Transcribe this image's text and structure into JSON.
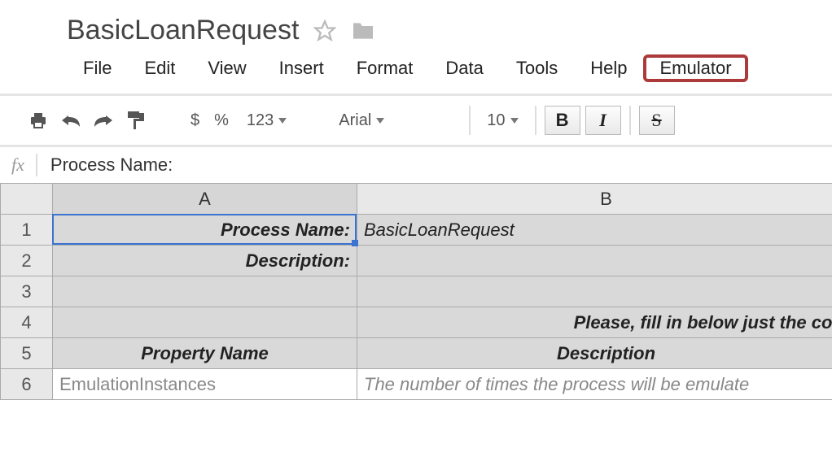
{
  "doc": {
    "title": "BasicLoanRequest"
  },
  "menu": {
    "file": "File",
    "edit": "Edit",
    "view": "View",
    "insert": "Insert",
    "format": "Format",
    "data": "Data",
    "tools": "Tools",
    "help": "Help",
    "emulator": "Emulator"
  },
  "toolbar": {
    "currency": "$",
    "percent": "%",
    "numfmt": "123",
    "font": "Arial",
    "size": "10",
    "bold": "B",
    "italic": "I",
    "strike": "S"
  },
  "formula": {
    "fx": "fx",
    "value": "Process Name:"
  },
  "columns": {
    "A": "A",
    "B": "B"
  },
  "rows": {
    "r1": {
      "num": "1",
      "a": "Process Name:",
      "b": "BasicLoanRequest"
    },
    "r2": {
      "num": "2",
      "a": "Description:",
      "b": ""
    },
    "r3": {
      "num": "3",
      "a": "",
      "b": ""
    },
    "r4": {
      "num": "4",
      "a": "",
      "b": "Please, fill in below just the colu"
    },
    "r5": {
      "num": "5",
      "a": "Property Name",
      "b": "Description"
    },
    "r6": {
      "num": "6",
      "a": "EmulationInstances",
      "b": "The number of times the process will be emulate"
    }
  }
}
